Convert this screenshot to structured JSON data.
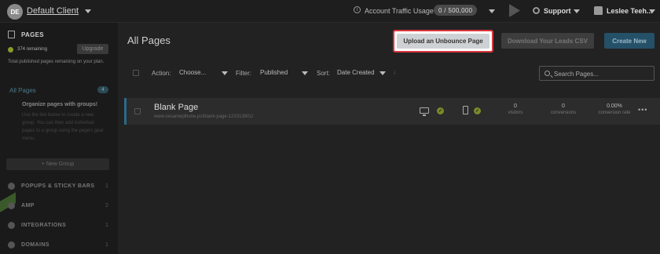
{
  "topbar": {
    "avatar_initials": "DE",
    "client_name": "Default Client",
    "traffic_label": "Account Traffic Usage",
    "traffic_value": "0 / 500,000",
    "support_label": "Support",
    "user_name": "Leslee Teeh..."
  },
  "sidebar": {
    "pages_title": "PAGES",
    "remaining": "374 remaining",
    "upgrade_label": "Upgrade",
    "description": "Total published pages remaining on your plan.",
    "all_pages_label": "All Pages",
    "all_pages_count": "4",
    "organize_title": "Organize pages with groups!",
    "organize_desc": "Use the link below to create a new group. You can then add individual pages to a group using the page's gear menu.",
    "new_group_label": "+ New Group",
    "sections": [
      {
        "label": "POPUPS & STICKY BARS",
        "count": "1"
      },
      {
        "label": "AMP",
        "count": "2"
      },
      {
        "label": "INTEGRATIONS",
        "count": "1"
      },
      {
        "label": "DOMAINS",
        "count": "1"
      }
    ]
  },
  "main": {
    "title": "All Pages",
    "upload_button": "Upload an Unbounce Page",
    "leads_button": "Download Your Leads CSV",
    "create_button": "Create New",
    "action_label": "Action:",
    "action_value": "Choose...",
    "filter_label": "Filter:",
    "filter_value": "Published",
    "sort_label": "Sort:",
    "sort_value": "Date Created",
    "search_placeholder": "Search Pages...",
    "rows": [
      {
        "title": "Blank Page",
        "url": "www.sesameplhone.ps/blank-page-123313601/",
        "visitors": "0",
        "visitors_label": "visitors",
        "conversions": "0",
        "conversions_label": "conversions",
        "conversion_rate": "0.00%",
        "conversion_rate_label": "conversion rate"
      }
    ]
  },
  "colors": {
    "highlight_border": "#d9363e",
    "accent_blue": "#245068",
    "status_green": "#7a8a2a"
  }
}
